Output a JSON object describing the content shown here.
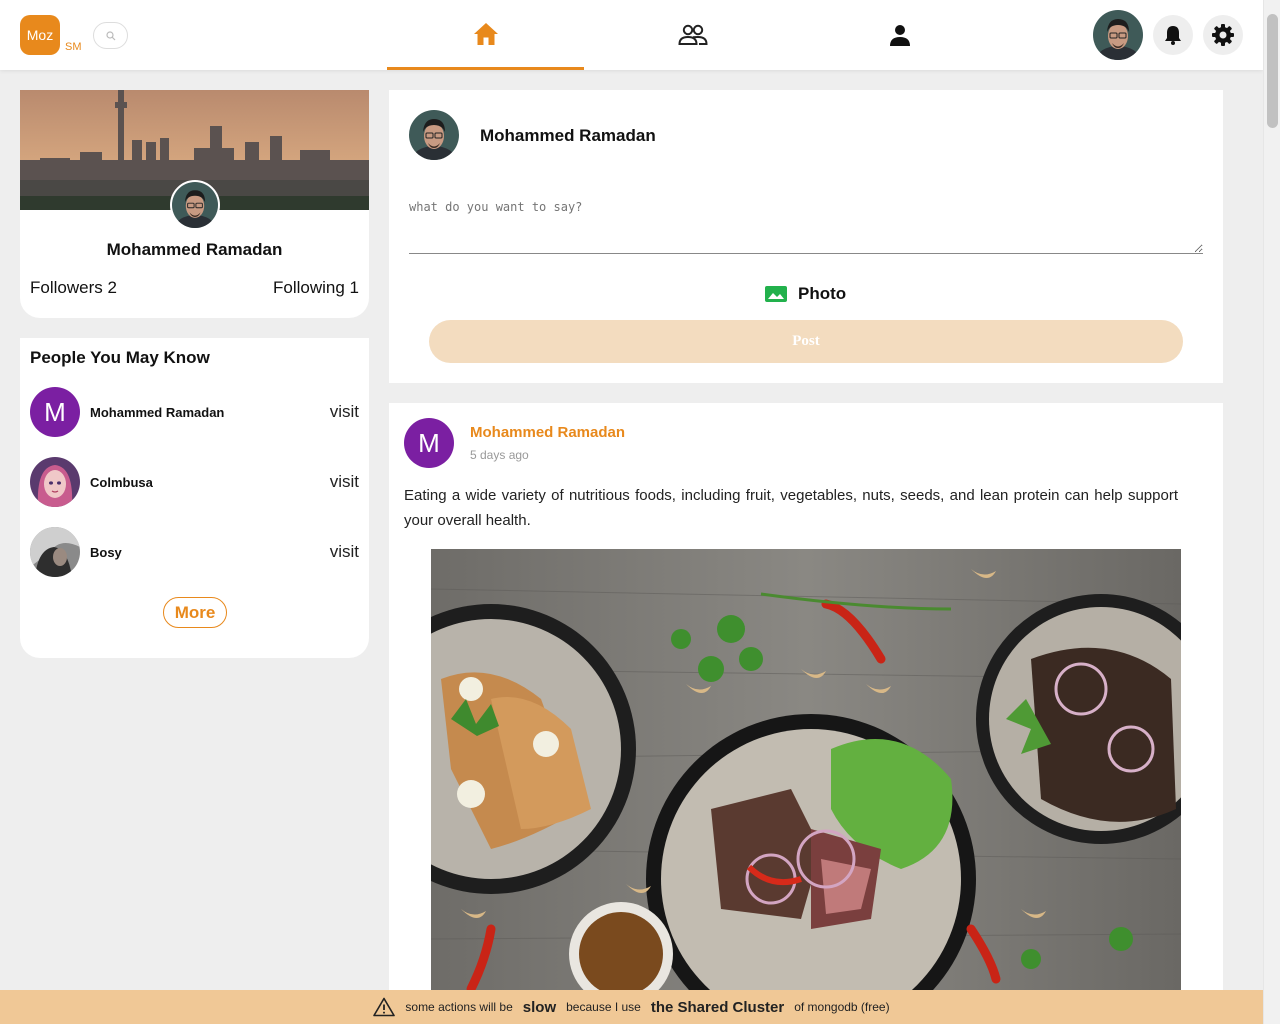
{
  "header": {
    "logo_text": "Moz",
    "logo_sub": "SM",
    "nav": [
      {
        "icon": "home-icon",
        "active": true
      },
      {
        "icon": "friends-icon",
        "active": false
      },
      {
        "icon": "profile-icon",
        "active": false
      }
    ],
    "icons": [
      "search-icon",
      "bell-icon",
      "gear-icon"
    ]
  },
  "profile": {
    "name": "Mohammed Ramadan",
    "followers_label": "Followers 2",
    "following_label": "Following 1"
  },
  "people": {
    "title": "People You May Know",
    "items": [
      {
        "name": "Mohammed Ramadan",
        "initial": "M",
        "action": "visit"
      },
      {
        "name": "Colmbusa",
        "action": "visit"
      },
      {
        "name": "Bosy",
        "action": "visit"
      }
    ],
    "more_label": "More"
  },
  "composer": {
    "name": "Mohammed Ramadan",
    "placeholder": "what do you want to say?",
    "photo_label": "Photo",
    "post_label": "Post"
  },
  "post": {
    "initial": "M",
    "author": "Mohammed Ramadan",
    "time": "5 days ago",
    "text": "Eating a wide variety of nutritious foods, including fruit, vegetables, nuts, seeds, and lean protein can help support your overall health."
  },
  "banner": {
    "part1": "some actions will be",
    "part2": "slow",
    "part3": "because I use",
    "part4": "the Shared Cluster",
    "part5": "of mongodb (free)"
  },
  "colors": {
    "accent": "#e8891c",
    "avatar_purple": "#7b1fa2",
    "post_button": "#f3dcbf",
    "banner": "#f0c896"
  }
}
